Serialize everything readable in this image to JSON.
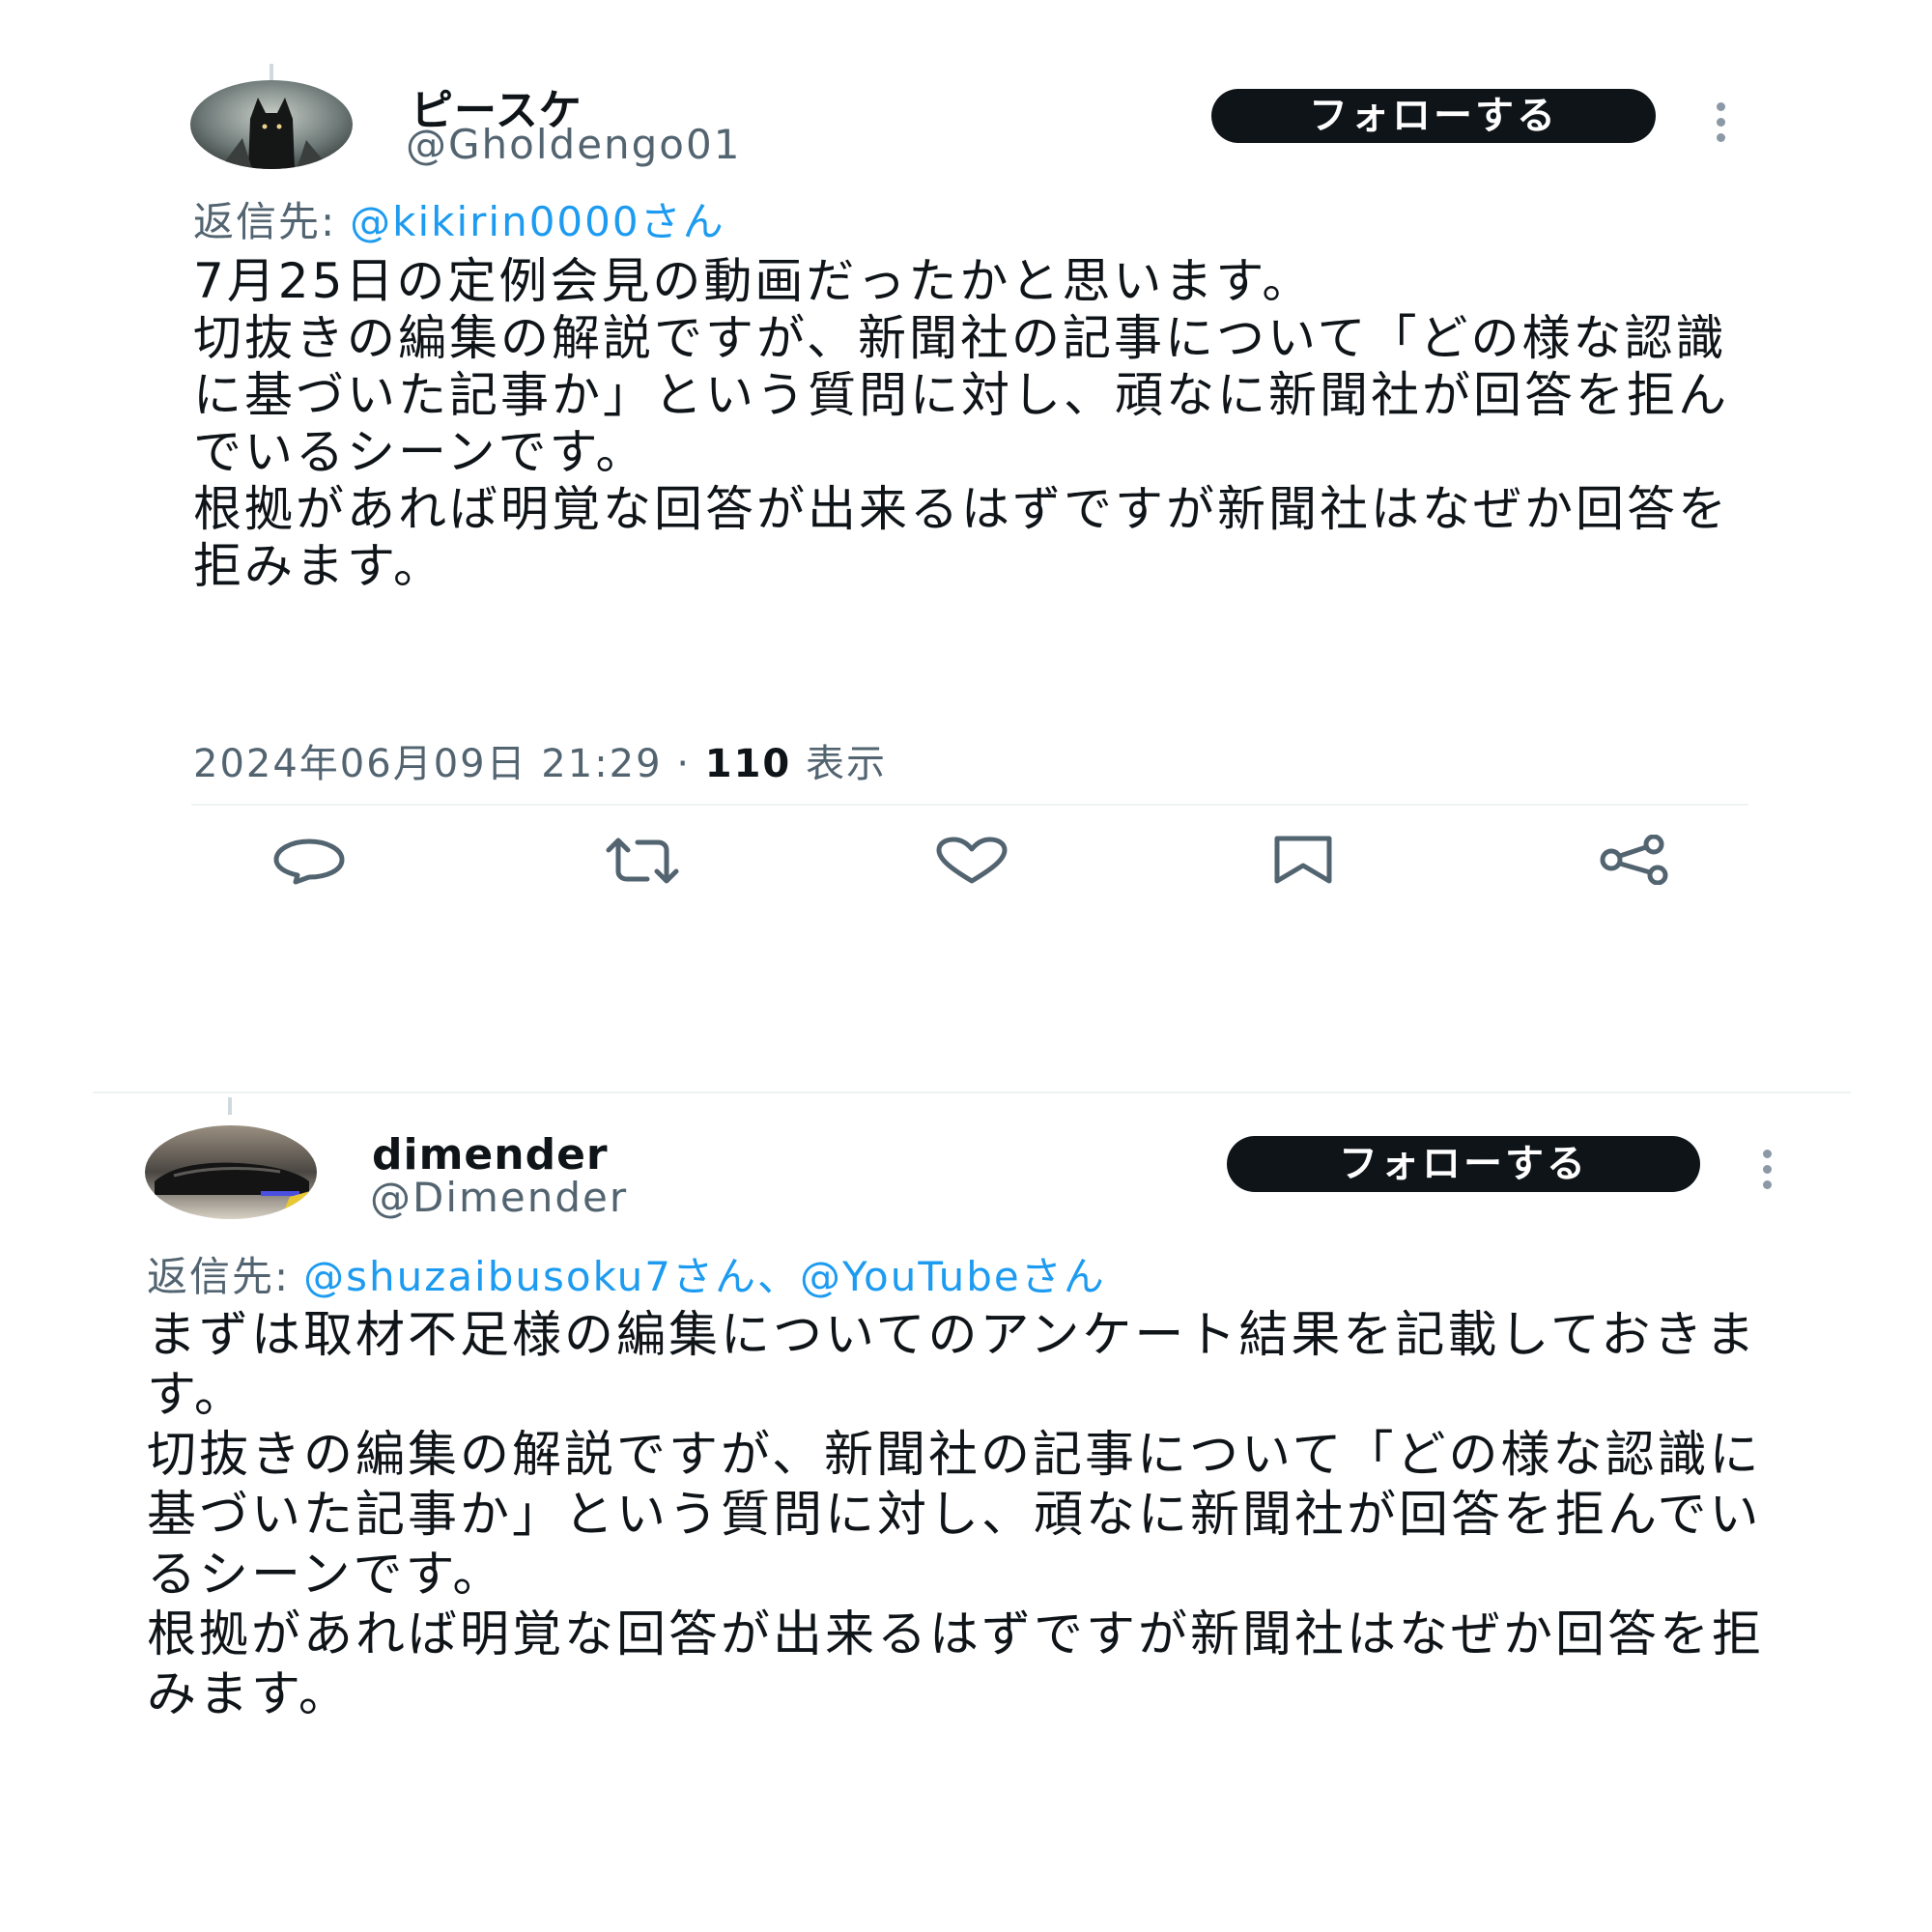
{
  "posts": [
    {
      "display_name": "ピースケ",
      "handle": "@Gholdengo01",
      "follow_label": "フォローする",
      "reply_prefix": "返信先:",
      "reply_mentions": "@kikirin0000さん",
      "body": "7月25日の定例会見の動画だったかと思います。\n切抜きの編集の解説ですが、新聞社の記事について「どの様な認識に基づいた記事か」という質問に対し、頑なに新聞社が回答を拒んでいるシーンです。\n根拠があれば明覚な回答が出来るはずですが新聞社はなぜか回答を拒みます。",
      "timestamp": "2024年06月09日 21:29",
      "separator": "·",
      "views_count": "110",
      "views_label": "表示",
      "avatar_icon": "black-wolf-avatar"
    },
    {
      "display_name": "dimender",
      "handle": "@Dimender",
      "follow_label": "フォローする",
      "reply_prefix": "返信先:",
      "reply_mentions": "@shuzaibusoku7さん、@YouTubeさん",
      "body": "まずは取材不足様の編集についてのアンケート結果を記載しておきます。\n切抜きの編集の解説ですが、新聞社の記事について「どの様な認識に基づいた記事か」という質問に対し、頑なに新聞社が回答を拒んでいるシーンです。\n根拠があれば明覚な回答が出来るはずですが新聞社はなぜか回答を拒みます。",
      "avatar_icon": "car-avatar"
    }
  ],
  "actions": [
    "reply-icon",
    "repost-icon",
    "like-icon",
    "bookmark-icon",
    "share-icon"
  ],
  "colors": {
    "text": "#0f1419",
    "secondary": "#536471",
    "link": "#1d9bf0",
    "button": "#0f1419"
  }
}
